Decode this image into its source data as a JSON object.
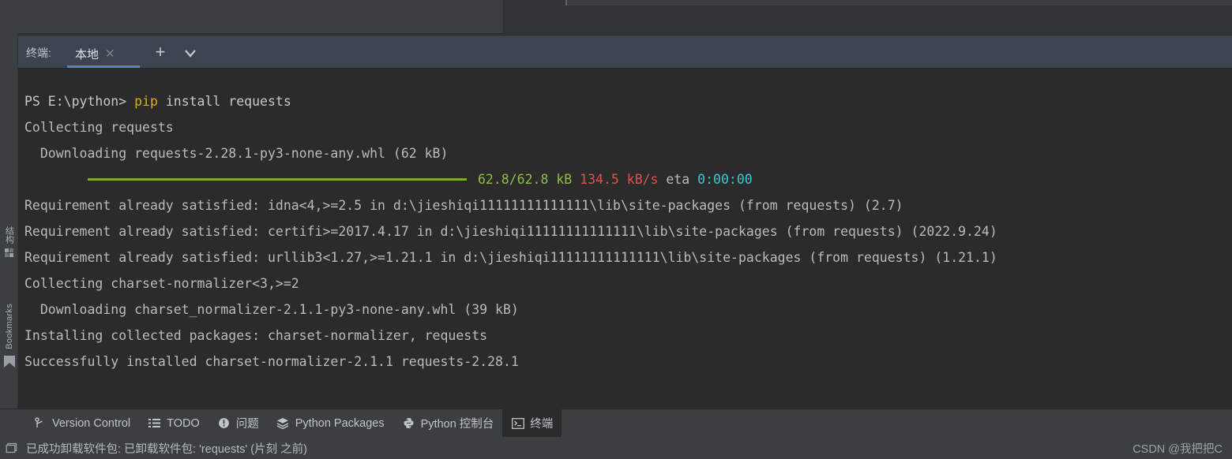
{
  "terminal_panel": {
    "label": "终端:",
    "tab_title": "本地",
    "close_icon": "close-icon",
    "add_icon": "plus-icon",
    "dropdown_icon": "chevron-down-icon",
    "accent_color": "#4a88c7",
    "background_color": "#2b2b2b"
  },
  "left_strip": {
    "items": [
      {
        "label": "结构",
        "icon": "structure-icon"
      },
      {
        "label": "Bookmarks",
        "icon": "bookmark-icon"
      }
    ]
  },
  "console": {
    "lines": [
      {
        "type": "prompt",
        "segments": [
          {
            "text": "PS E:\\python> ",
            "color": "white"
          },
          {
            "text": "pip",
            "color": "yellow"
          },
          {
            "text": " install requests",
            "color": "white"
          }
        ]
      },
      {
        "type": "text",
        "segments": [
          {
            "text": "Collecting requests",
            "color": "gray"
          }
        ]
      },
      {
        "type": "text",
        "segments": [
          {
            "text": "  Downloading requests-2.28.1-py3-none-any.whl (62 kB)",
            "color": "gray"
          }
        ]
      },
      {
        "type": "progress",
        "bar_color": "#7aae2f",
        "bar_percent": 100,
        "segments": [
          {
            "text": "62.8/62.8 kB",
            "color": "green"
          },
          {
            "text": " ",
            "color": "gray"
          },
          {
            "text": "134.5 kB/s",
            "color": "red"
          },
          {
            "text": " eta ",
            "color": "gray"
          },
          {
            "text": "0:00:00",
            "color": "cyan"
          }
        ]
      },
      {
        "type": "text",
        "segments": [
          {
            "text": "Requirement already satisfied: idna<4,>=2.5 in d:\\jieshiqi11111111111111\\lib\\site-packages (from requests) (2.7)",
            "color": "gray"
          }
        ]
      },
      {
        "type": "text",
        "segments": [
          {
            "text": "Requirement already satisfied: certifi>=2017.4.17 in d:\\jieshiqi11111111111111\\lib\\site-packages (from requests) (2022.9.24)",
            "color": "gray"
          }
        ]
      },
      {
        "type": "text",
        "segments": [
          {
            "text": "Requirement already satisfied: urllib3<1.27,>=1.21.1 in d:\\jieshiqi11111111111111\\lib\\site-packages (from requests) (1.21.1)",
            "color": "gray"
          }
        ]
      },
      {
        "type": "text",
        "segments": [
          {
            "text": "Collecting charset-normalizer<3,>=2",
            "color": "gray"
          }
        ]
      },
      {
        "type": "text",
        "segments": [
          {
            "text": "  Downloading charset_normalizer-2.1.1-py3-none-any.whl (39 kB)",
            "color": "gray"
          }
        ]
      },
      {
        "type": "text",
        "segments": [
          {
            "text": "Installing collected packages: charset-normalizer, requests",
            "color": "gray"
          }
        ]
      },
      {
        "type": "text",
        "segments": [
          {
            "text": "Successfully installed charset-normalizer-2.1.1 requests-2.28.1",
            "color": "gray"
          }
        ]
      }
    ]
  },
  "bottom_bar": {
    "items": [
      {
        "label": "Version Control",
        "icon": "branch-icon",
        "selected": false
      },
      {
        "label": "TODO",
        "icon": "list-icon",
        "selected": false
      },
      {
        "label": "问题",
        "icon": "warning-icon",
        "selected": false
      },
      {
        "label": "Python Packages",
        "icon": "layers-icon",
        "selected": false
      },
      {
        "label": "Python 控制台",
        "icon": "python-icon",
        "selected": false
      },
      {
        "label": "终端",
        "icon": "terminal-icon",
        "selected": true
      }
    ]
  },
  "status_bar": {
    "icon": "window-icon",
    "message": "已成功卸载软件包: 已卸载软件包: 'requests' (片刻 之前)",
    "watermark": "CSDN @我把把C"
  }
}
